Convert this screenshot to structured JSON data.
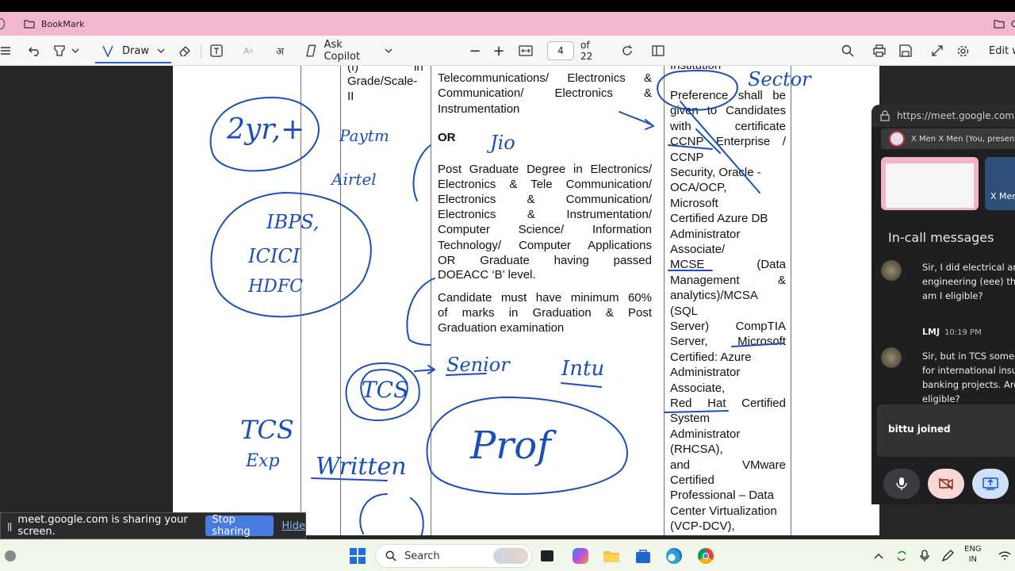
{
  "tabs": {
    "active": "BookMark",
    "right_tab": "O"
  },
  "toolbar": {
    "draw_label": "Draw",
    "copilot_label": "Ask Copilot",
    "page_current": "4",
    "page_total": "of 22",
    "edit_label": "Edit w"
  },
  "document": {
    "col_a_top": "(f)",
    "col_a_grade": "Grade/Scale-",
    "col_a_grade2": "II",
    "col_a_in": "in",
    "col_b_lines": [
      "Telecommunications/ Electronics &",
      "Communication/ Electronics &",
      "Instrumentation"
    ],
    "or_text": "OR",
    "col_b_pg_lines": [
      "Post Graduate Degree in Electronics/",
      "Electronics & Tele Communication/",
      "Electronics & Communication/",
      "Electronics & Instrumentation/",
      "Computer Science/ Information",
      "Technology/ Computer Applications",
      "OR Graduate having passed"
    ],
    "col_b_pg_last": "DOEACC ‘B’ level.",
    "col_b_marks_lines": [
      "Candidate must have minimum 60%",
      "of marks in Graduation & Post"
    ],
    "col_b_marks_last": "Graduation examination",
    "col_c_top": "Institution",
    "col_c_lines": [
      "Preference shall be",
      "given to Candidates",
      "with certificate",
      "CCNP Enterprise /"
    ],
    "col_c_single": [
      "CCNP",
      "Security, Oracle -",
      "OCA/OCP,",
      "Microsoft",
      "Certified Azure DB",
      "Administrator",
      "Associate/"
    ],
    "col_c_lines2": [
      "MCSE (Data",
      "Management &",
      "analytics)/MCSA"
    ],
    "col_c_single2": [
      "(SQL"
    ],
    "col_c_lines3": [
      "Server) CompTIA",
      "Server, Microsoft"
    ],
    "col_c_single3": [
      "Certified: Azure",
      "Administrator",
      "Associate,"
    ],
    "col_c_lines4": [
      "Red Hat Certified"
    ],
    "col_c_single4": [
      "System",
      "Administrator",
      "(RHCSA),"
    ],
    "col_c_lines5": [
      "and VMware"
    ],
    "col_c_single5": [
      "Certified",
      "Professional – Data",
      "Center Virtualization",
      "(VCP-DCV),"
    ],
    "handwriting": [
      "2yr,+",
      "IBPS,",
      "ICICI",
      "HDFC",
      "TCS",
      "Senior",
      "Intu",
      "Prof",
      "TCS",
      "Exp",
      "Written",
      "Paytm",
      "Airtel",
      "Jio",
      "Sector"
    ]
  },
  "share_banner": {
    "message": "meet.google.com is sharing your screen.",
    "stop_label": "Stop sharing",
    "hide_label": "Hide"
  },
  "meet_panel": {
    "url": "https://meet.google.com",
    "presenting": "X Men X Men (You, present",
    "tile_name": "X Men",
    "incall_title": "In-call messages",
    "msg1_lines": [
      "Sir, I did electrical and",
      "engineering (eee) tha",
      "am I eligible?"
    ],
    "msg2_sender": "LMJ",
    "msg2_time": "10:19 PM",
    "msg2_lines": [
      "Sir, but in TCS someo",
      "for international insu",
      "banking projects. Are",
      "eligible?"
    ],
    "joined_toast": "bittu joined"
  },
  "taskbar": {
    "search_label": "Search",
    "lang_line1": "ENG",
    "lang_line2": "IN"
  },
  "colors": {
    "tab_bar": "#f3b6cf",
    "ink": "#1a4fb8",
    "stop_button": "#4a7be0"
  }
}
